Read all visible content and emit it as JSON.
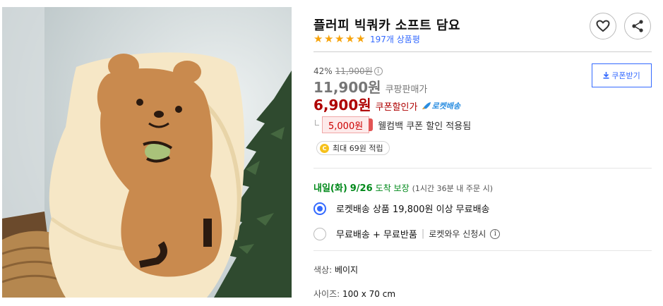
{
  "product": {
    "title": "플러피 빅쿼카 소프트 담요",
    "rating_stars": 5,
    "review_count": "197개 상품평"
  },
  "price": {
    "discount_pct": "42%",
    "original": "11,900원",
    "coupang_price": "11,900원",
    "coupang_label": "쿠팡판매가",
    "sale_price": "6,900원",
    "sale_label": "쿠폰할인가",
    "rocket_label": "로켓배송"
  },
  "coupon": {
    "amount": "5,000원",
    "text": "웰컴백 쿠폰 할인 적용됨",
    "button_label": "쿠폰받기"
  },
  "cash": {
    "coin_label": "C",
    "text": "최대 69원 적립"
  },
  "delivery": {
    "day": "내일(화)",
    "date": "9/26",
    "guarantee": "도착 보장",
    "condition": "(1시간 36분 내 주문 시)"
  },
  "shipping_options": [
    {
      "label": "로켓배송 상품 19,800원 이상 무료배송",
      "selected": true
    },
    {
      "label": "무료배송 + 무료반품",
      "sub": "로켓와우 신청시",
      "selected": false
    }
  ],
  "specs": [
    {
      "key": "색상:",
      "value": "베이지"
    },
    {
      "key": "사이즈:",
      "value": "100 x 70 cm"
    }
  ],
  "icons": {
    "heart": "heart-icon",
    "share": "share-icon",
    "star": "star-icon",
    "download": "download-icon",
    "info": "info-icon"
  },
  "colors": {
    "accent_blue": "#346aff",
    "sale_red": "#ae0000",
    "delivery_green": "#00891a",
    "star_orange": "#f7a30a"
  }
}
